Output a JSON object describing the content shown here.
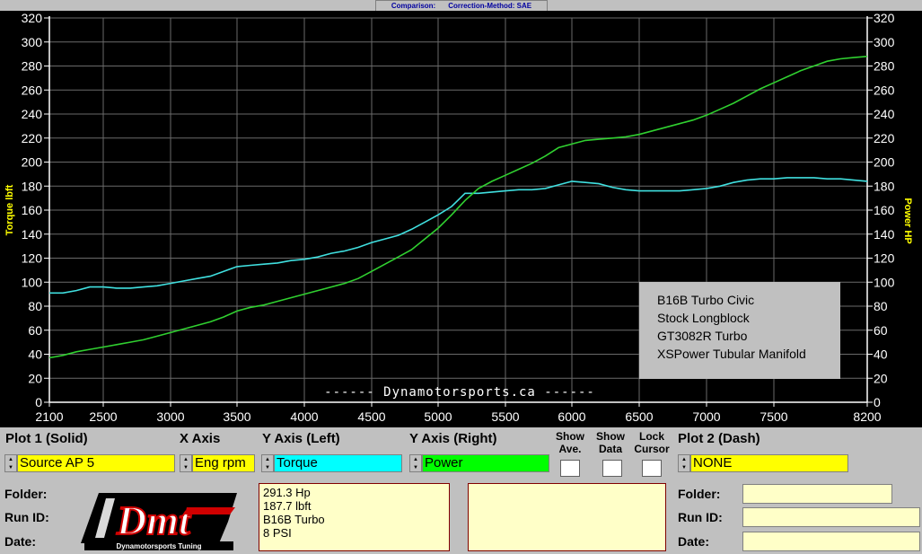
{
  "title_bar": {
    "comparison": "Comparison:",
    "correction": "Correction-Method: SAE"
  },
  "chart_data": {
    "type": "line",
    "xlim": [
      2100,
      8200
    ],
    "x_ticks": [
      2100,
      2500,
      3000,
      3500,
      4000,
      4500,
      5000,
      5500,
      6000,
      6500,
      7000,
      7500,
      8200
    ],
    "ylim": [
      0,
      320
    ],
    "y_ticks": [
      0,
      20,
      40,
      60,
      80,
      100,
      120,
      140,
      160,
      180,
      200,
      220,
      240,
      260,
      280,
      300,
      320
    ],
    "y_left_label": "Torque lbft",
    "y_right_label": "Power HP",
    "grid": true,
    "series": [
      {
        "color": "#40e0e0",
        "x": [
          2100,
          2200,
          2300,
          2400,
          2500,
          2600,
          2700,
          2800,
          2900,
          3000,
          3100,
          3200,
          3300,
          3400,
          3500,
          3600,
          3700,
          3800,
          3900,
          4000,
          4100,
          4200,
          4300,
          4400,
          4500,
          4600,
          4700,
          4800,
          4900,
          5000,
          5100,
          5200,
          5300,
          5400,
          5500,
          5600,
          5700,
          5800,
          5900,
          6000,
          6100,
          6200,
          6300,
          6400,
          6500,
          6600,
          6700,
          6800,
          6900,
          7000,
          7100,
          7200,
          7300,
          7400,
          7500,
          7600,
          7700,
          7800,
          7900,
          8000,
          8100,
          8200
        ],
        "values": [
          91,
          91,
          93,
          96,
          96,
          95,
          95,
          96,
          97,
          99,
          101,
          103,
          105,
          109,
          113,
          114,
          115,
          116,
          118,
          119,
          121,
          124,
          126,
          129,
          133,
          136,
          139,
          144,
          150,
          156,
          163,
          174,
          174,
          175,
          176,
          177,
          177,
          178,
          181,
          184,
          183,
          182,
          179,
          177,
          176,
          176,
          176,
          176,
          177,
          178,
          180,
          183,
          185,
          186,
          186,
          187,
          187,
          187,
          186,
          186,
          185,
          184
        ]
      },
      {
        "color": "#30d030",
        "x": [
          2100,
          2200,
          2300,
          2400,
          2500,
          2600,
          2700,
          2800,
          2900,
          3000,
          3100,
          3200,
          3300,
          3400,
          3500,
          3600,
          3700,
          3800,
          3900,
          4000,
          4100,
          4200,
          4300,
          4400,
          4500,
          4600,
          4700,
          4800,
          4900,
          5000,
          5100,
          5200,
          5300,
          5400,
          5500,
          5600,
          5700,
          5800,
          5900,
          6000,
          6100,
          6200,
          6300,
          6400,
          6500,
          6600,
          6700,
          6800,
          6900,
          7000,
          7100,
          7200,
          7300,
          7400,
          7500,
          7600,
          7700,
          7800,
          7900,
          8000,
          8100,
          8200
        ],
        "values": [
          37,
          39,
          42,
          44,
          46,
          48,
          50,
          52,
          55,
          58,
          61,
          64,
          67,
          71,
          76,
          79,
          81,
          84,
          87,
          90,
          93,
          96,
          99,
          103,
          109,
          115,
          121,
          127,
          136,
          145,
          156,
          168,
          178,
          184,
          189,
          194,
          199,
          205,
          212,
          215,
          218,
          219,
          220,
          221,
          223,
          226,
          229,
          232,
          235,
          239,
          244,
          249,
          255,
          261,
          266,
          271,
          276,
          280,
          284,
          286,
          287,
          288
        ]
      }
    ],
    "legend_box": [
      "B16B Turbo Civic",
      "Stock Longblock",
      "GT3082R Turbo",
      "XSPower Tubular Manifold"
    ],
    "watermark": "------ Dynamotorsports.ca ------"
  },
  "controls": {
    "plot1": {
      "header": "Plot 1 (Solid)",
      "value": "Source AP 5",
      "bg": "#ffff00"
    },
    "xaxis": {
      "header": "X Axis",
      "value": "Eng rpm",
      "bg": "#ffff00"
    },
    "yleft": {
      "header": "Y Axis (Left)",
      "value": "Torque",
      "bg": "#00ffff"
    },
    "yright": {
      "header": "Y Axis (Right)",
      "value": "Power",
      "bg": "#00ff00"
    },
    "show_ave": {
      "line1": "Show",
      "line2": "Ave."
    },
    "show_data": {
      "line1": "Show",
      "line2": "Data"
    },
    "lock_cursor": {
      "line1": "Lock",
      "line2": "Cursor"
    },
    "plot2": {
      "header": "Plot 2 (Dash)",
      "value": "NONE",
      "bg": "#ffff00"
    }
  },
  "left_fields": {
    "folder": "Folder:",
    "run_id": "Run ID:",
    "date": "Date:"
  },
  "right_fields": {
    "folder": "Folder:",
    "run_id": "Run ID:",
    "date": "Date:"
  },
  "info_box": {
    "lines": [
      "291.3 Hp",
      "187.7 lbft",
      "B16B Turbo",
      "8 PSI"
    ]
  },
  "logo": {
    "text": "Dmt",
    "subtitle": "Dynamotorsports Tuning"
  }
}
